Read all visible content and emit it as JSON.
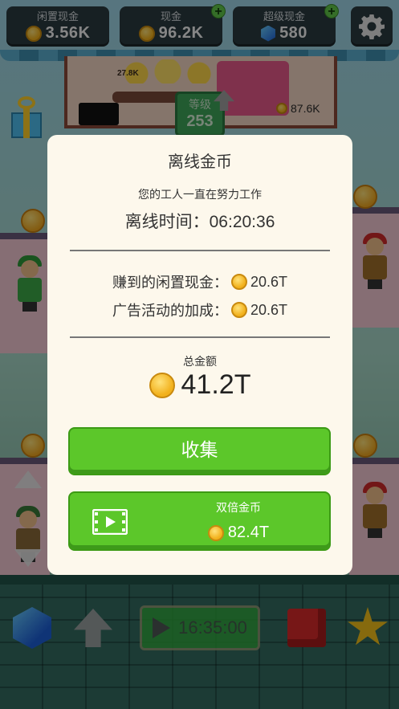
{
  "topbar": {
    "idle_cash": {
      "label": "闲置现金",
      "value": "3.56K",
      "icon": "coin-icon"
    },
    "cash": {
      "label": "现金",
      "value": "96.2K",
      "icon": "coin-icon",
      "add_icon": "plus-icon"
    },
    "super_cash": {
      "label": "超级现金",
      "value": "580",
      "icon": "gem-icon",
      "add_icon": "plus-icon"
    },
    "settings_icon": "gear-icon"
  },
  "scene": {
    "factory_output": "27.8K",
    "level_label": "等级",
    "level_value": "253",
    "factory_cash": "87.6K"
  },
  "modal": {
    "title": "离线金币",
    "subtitle": "您的工人一直在努力工作",
    "offline_time_label": "离线时间：",
    "offline_time_value": "06:20:36",
    "idle_cash_earned_label": "赚到的闲置现金：",
    "idle_cash_earned_value": "20.6T",
    "ad_bonus_label": "广告活动的加成：",
    "ad_bonus_value": "20.6T",
    "total_label": "总金额",
    "total_value": "41.2T",
    "collect_button": "收集",
    "double_button_label": "双倍金币",
    "double_button_value": "82.4T",
    "double_button_icon": "video-icon"
  },
  "bottombar": {
    "timer": "16:35:00"
  },
  "colors": {
    "button_green": "#5cc72a",
    "modal_bg": "#fdf8ec",
    "coin_gold": "#f2b11c"
  }
}
